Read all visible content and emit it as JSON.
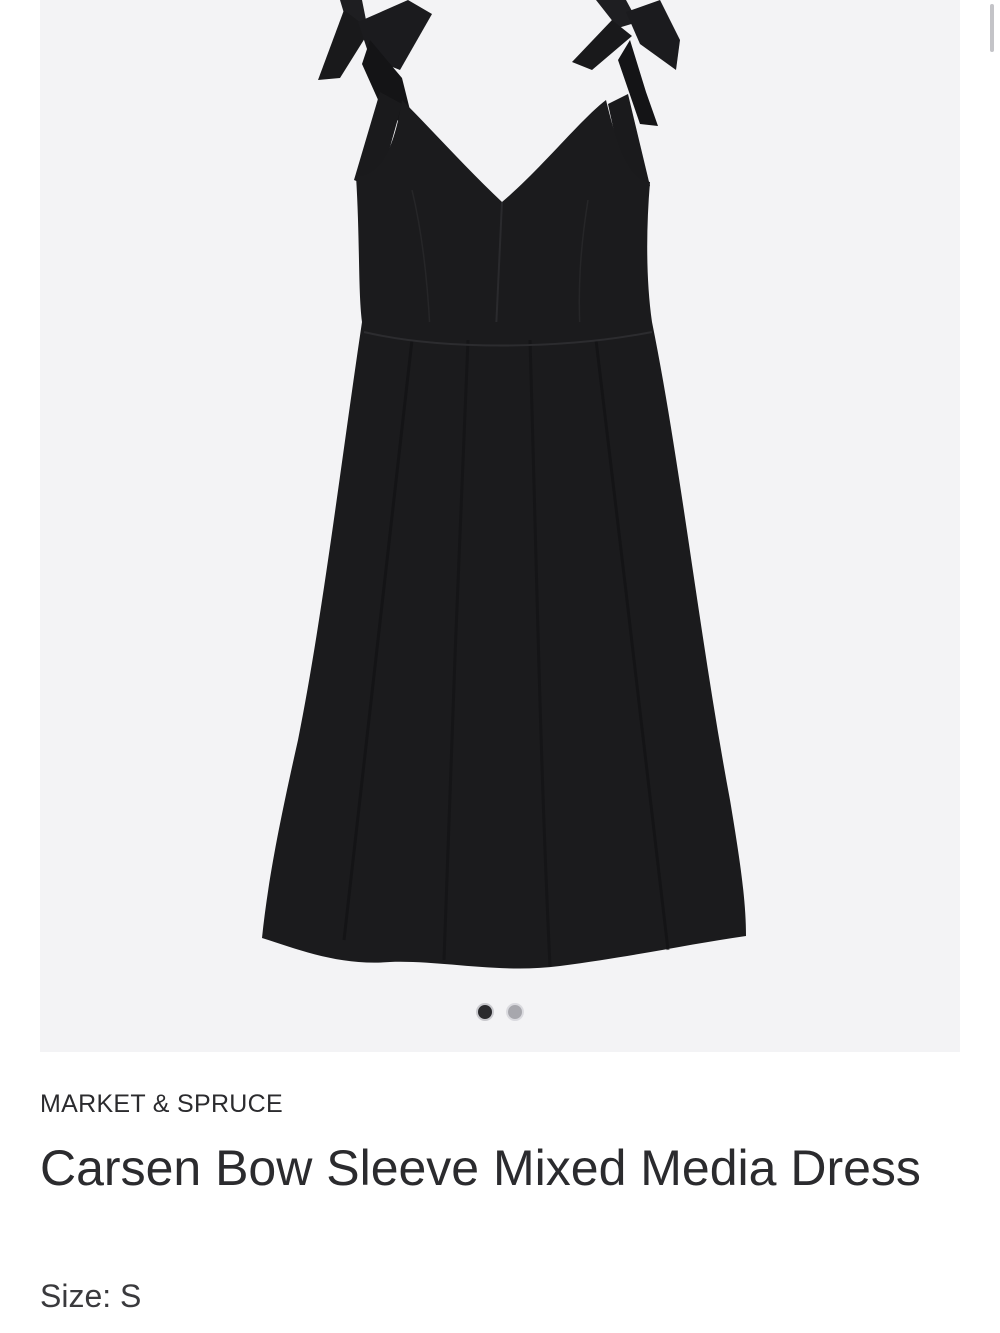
{
  "product": {
    "brand": "MARKET & SPRUCE",
    "title": "Carsen Bow Sleeve Mixed Media Dress",
    "size_label": "Size: S",
    "image": {
      "icon": "dress-photo",
      "background_color": "#f3f3f5",
      "dress_color": "#1b1b1d"
    },
    "carousel": {
      "total": 2,
      "active_index": 0
    }
  }
}
